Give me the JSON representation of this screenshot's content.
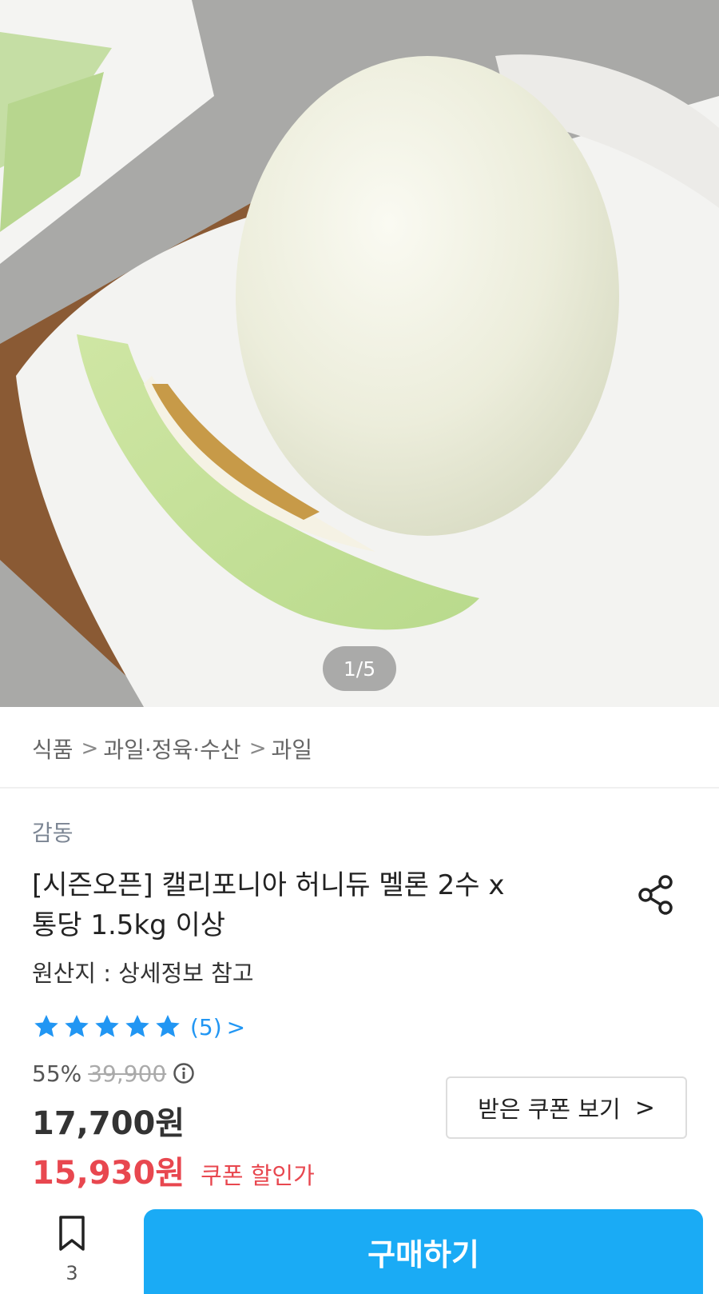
{
  "hero": {
    "indicator": "1/5",
    "image_alt": "honeydew melon on white cloth"
  },
  "breadcrumb": {
    "items": [
      "식품",
      "과일·정육·수산",
      "과일"
    ],
    "separator": ">"
  },
  "product": {
    "brand": "감동",
    "title_line1": "[시즌오픈] 캘리포니아 허니듀 멜론 2수 x",
    "title_line2": "통당 1.5kg 이상",
    "origin": "원산지 : 상세정보 참고",
    "rating_stars": 5,
    "review_count": "(5)",
    "review_chevron": ">",
    "discount_rate": "55%",
    "original_price": "39,900",
    "sale_price": "17,700원",
    "coupon_price": "15,930원",
    "coupon_price_label": "쿠폰 할인가"
  },
  "coupon_button": {
    "label": "받은 쿠폰 보기",
    "chevron": ">"
  },
  "bottom_bar": {
    "bookmark_count": "3",
    "buy_label": "구매하기"
  },
  "colors": {
    "accent_blue": "#1aabf5",
    "star_blue": "#2196f3",
    "coupon_red": "#e8474f"
  }
}
